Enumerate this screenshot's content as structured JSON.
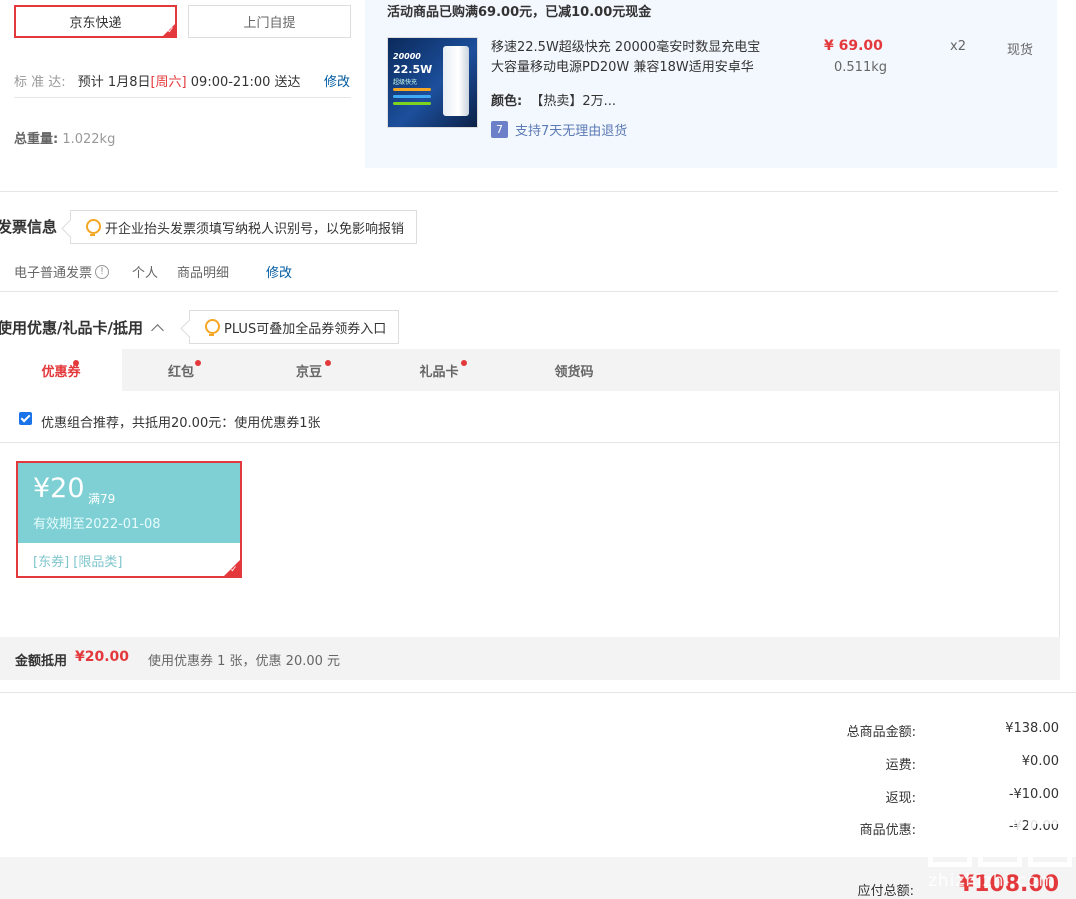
{
  "shipping": {
    "jd_express": "京东快递",
    "self_pickup": "上门自提",
    "standard_label": "标 准 达:",
    "standard_text_pre": "预计 1月8日",
    "standard_day": "[周六]",
    "standard_text_post": " 09:00-21:00 送达",
    "modify": "修改",
    "weight_label": "总重量:",
    "weight_value": "1.022kg"
  },
  "goods": {
    "promo": "活动商品已购满69.00元，已减10.00元现金",
    "thumb_line1": "20000",
    "thumb_line2": "22.5W",
    "thumb_line3": "超级快充",
    "name_line1": "移速22.5W超级快充 20000毫安时数显充电宝",
    "name_line2": "大容量移动电源PD20W 兼容18W适用安卓华",
    "color_label": "颜色:",
    "color_value": "【热卖】2万...",
    "return_icon": "7",
    "return_text": "支持7天无理由退货",
    "price": "¥ 69.00",
    "weight": "0.511kg",
    "qty": "x2",
    "stock": "现货"
  },
  "invoice": {
    "title": "发票信息",
    "tip": "开企业抬头发票须填写纳税人识别号，以免影响报销",
    "type": "电子普通发票",
    "person": "个人",
    "detail": "商品明细",
    "modify": "修改"
  },
  "discount": {
    "title": "使用优惠/礼品卡/抵用",
    "tip": "PLUS可叠加全品券领券入口",
    "tabs": [
      {
        "label": "优惠券"
      },
      {
        "label": "红包"
      },
      {
        "label": "京豆"
      },
      {
        "label": "礼品卡"
      },
      {
        "label": "领货码"
      }
    ],
    "recommend": "优惠组合推荐，共抵用20.00元：使用优惠券1张",
    "coupon": {
      "amount": "¥20",
      "condition": "满79",
      "expiry": "有效期至2022-01-08",
      "tags": "[东券]  [限品类]"
    },
    "summary_label": "金额抵用",
    "summary_amount": "¥20.00",
    "summary_text": "使用优惠券 1 张，优惠 20.00 元"
  },
  "totals": {
    "goods_label": "总商品金额:",
    "goods_value": "¥138.00",
    "freight_label": "运费:",
    "freight_value": "¥0.00",
    "rebate_label": "返现:",
    "rebate_value": "-¥10.00",
    "discount_label": "商品优惠:",
    "discount_value": "-¥20.00",
    "payable_label": "应付总额:",
    "payable_value": "¥108.00"
  },
  "watermark": {
    "text": "zhizhizhi.com"
  },
  "colors": {
    "accent": "#e4393c",
    "link": "#005aa0",
    "coupon": "#7fd0d5"
  }
}
